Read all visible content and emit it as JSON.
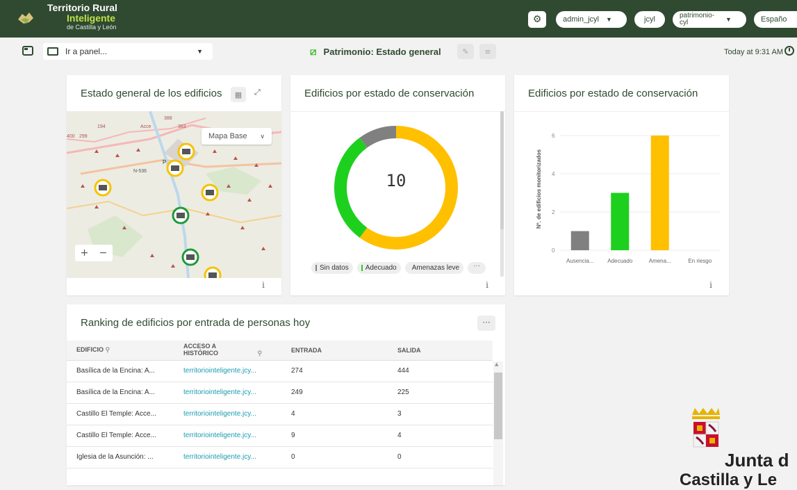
{
  "header": {
    "brand_line1": "Territorio Rural",
    "brand_line2": "Inteligente",
    "brand_line3": "de Castilla y León",
    "user": "admin_jcyl",
    "org": "jcyl",
    "tenant_line1": "patrimonio-",
    "tenant_line2": "cyl",
    "language": "Españo"
  },
  "toolbar": {
    "panel_placeholder": "Ir a panel...",
    "page_title": "Patrimonio: Estado general",
    "last_update": "Today at 9:31 AM"
  },
  "map_card": {
    "title": "Estado general de los edificios",
    "basemap_label": "Mapa Base",
    "zoom_in": "+",
    "zoom_out": "−",
    "place_labels": [
      "N-536",
      "P"
    ],
    "road_labels": [
      "400",
      "299",
      "194",
      "Acce",
      "383",
      "388"
    ],
    "info": "i"
  },
  "donut_card": {
    "title": "Edificios por estado de conservación",
    "total": "10",
    "legend": [
      {
        "label": "Sin datos",
        "color": "#808080"
      },
      {
        "label": "Adecuado",
        "color": "#1ed01e"
      },
      {
        "label": "Amenazas leve",
        "color": "#ffc000"
      }
    ],
    "more": "···",
    "info": "i"
  },
  "bar_card": {
    "title": "Edificios por estado de conservación",
    "info": "i"
  },
  "chart_data": [
    {
      "type": "pie",
      "title": "Edificios por estado de conservación",
      "center_label": "10",
      "categories": [
        "Sin datos",
        "Adecuado",
        "Amenazas leve"
      ],
      "values": [
        1,
        3,
        6
      ],
      "colors": [
        "#808080",
        "#1ed01e",
        "#ffc000"
      ]
    },
    {
      "type": "bar",
      "title": "Edificios por estado de conservación",
      "ylabel": "Nº. de edificios monitorizados",
      "categories": [
        "Ausencia...",
        "Adecuado",
        "Amena...",
        "En riesgo"
      ],
      "values": [
        1,
        3,
        6,
        0
      ],
      "colors": [
        "#808080",
        "#1ed01e",
        "#ffc000",
        "#cccccc"
      ],
      "yticks": [
        "0",
        "2",
        "4",
        "6"
      ],
      "ylim": [
        0,
        6.4
      ],
      "grid": true
    }
  ],
  "ranking": {
    "title": "Ranking de edificios por entrada de personas hoy",
    "menu": "···",
    "columns": [
      "EDIFICIO",
      "ACCESO A HISTÓRICO",
      "ENTRADA",
      "SALIDA"
    ],
    "rows": [
      [
        "Basílica de la Encina: A...",
        "territoriointeligente.jcy...",
        "274",
        "444"
      ],
      [
        "Basílica de la Encina: A...",
        "territoriointeligente.jcy...",
        "249",
        "225"
      ],
      [
        "Castillo El Temple: Acce...",
        "territoriointeligente.jcy...",
        "4",
        "3"
      ],
      [
        "Castillo El Temple: Acce...",
        "territoriointeligente.jcy...",
        "9",
        "4"
      ],
      [
        "Iglesia de la Asunción: ...",
        "territoriointeligente.jcy...",
        "0",
        "0"
      ]
    ]
  },
  "footer_logo": {
    "text_line1": "Junta d",
    "text_line2": "Castilla y Le"
  }
}
